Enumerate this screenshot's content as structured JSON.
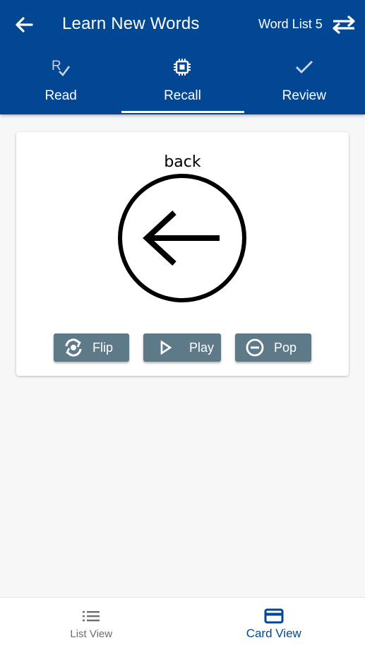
{
  "header": {
    "title": "Learn New Words",
    "list_name": "Word List 5",
    "back_icon": "arrow-left-icon",
    "swap_icon": "swap-arrows-icon"
  },
  "tabs": [
    {
      "label": "Read",
      "icon": "read-check-icon",
      "active": false
    },
    {
      "label": "Recall",
      "icon": "chip-icon",
      "active": true
    },
    {
      "label": "Review",
      "icon": "checkmark-icon",
      "active": false
    }
  ],
  "card": {
    "word": "back",
    "symbol_icon": "circle-arrow-left-icon",
    "buttons": [
      {
        "label": "Flip",
        "icon": "flip-icon"
      },
      {
        "label": "Play",
        "icon": "play-icon"
      },
      {
        "label": "Pop",
        "icon": "minus-circle-icon"
      }
    ]
  },
  "bottom_nav": [
    {
      "label": "List View",
      "icon": "list-icon",
      "active": false
    },
    {
      "label": "Card View",
      "icon": "card-icon",
      "active": true
    }
  ],
  "colors": {
    "primary": "#024794",
    "button": "#5e7a89",
    "background": "#f7f7f7"
  }
}
